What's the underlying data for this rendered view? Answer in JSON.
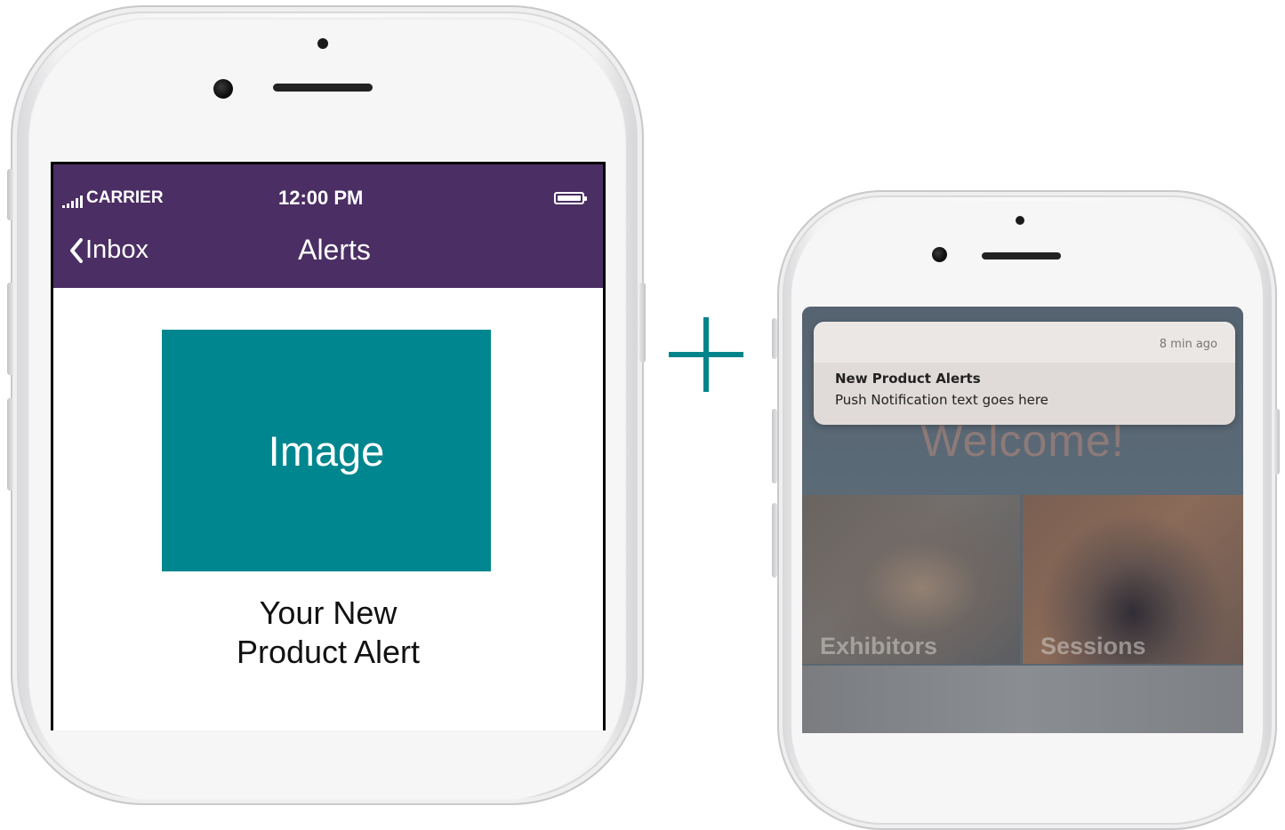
{
  "left_phone": {
    "status_bar": {
      "carrier": "CARRIER",
      "time": "12:00 PM"
    },
    "nav": {
      "back_label": "Inbox",
      "title": "Alerts"
    },
    "content": {
      "image_placeholder": "Image",
      "alert_title_line1": "Your New",
      "alert_title_line2": "Product Alert"
    }
  },
  "plus_symbol": "+",
  "right_phone": {
    "notification": {
      "time": "8 min ago",
      "title": "New Product Alerts",
      "body": "Push Notification text goes here"
    },
    "app": {
      "welcome": "Welcome!",
      "tiles": [
        {
          "label": "Exhibitors"
        },
        {
          "label": "Sessions"
        }
      ]
    }
  },
  "colors": {
    "nav_purple": "#4b2e63",
    "image_teal": "#00868e",
    "plus_teal": "#00848b"
  }
}
